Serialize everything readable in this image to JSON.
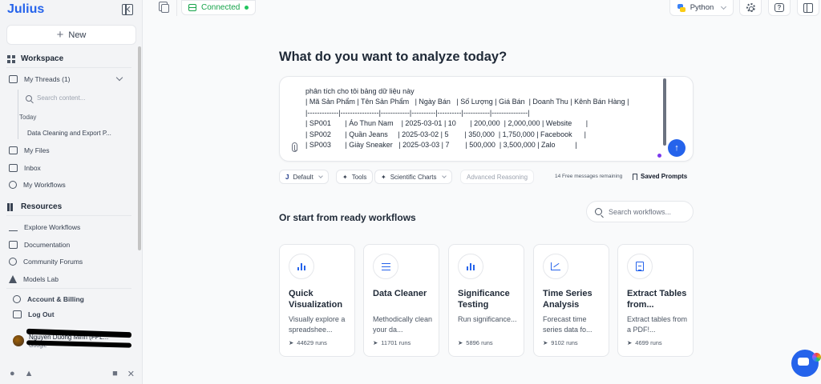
{
  "sidebar": {
    "logo": "Julius",
    "new_label": "New",
    "workspace_title": "Workspace",
    "my_threads_label": "My Threads",
    "my_threads_count": "(1)",
    "search_placeholder": "Search content...",
    "today_label": "Today",
    "thread_item": "Data Cleaning and Export P...",
    "my_files": "My Files",
    "inbox": "Inbox",
    "my_workflows": "My Workflows",
    "resources_title": "Resources",
    "explore_workflows": "Explore Workflows",
    "documentation": "Documentation",
    "community_forums": "Community Forums",
    "models_lab": "Models Lab",
    "account_billing": "Account & Billing",
    "log_out": "Log Out",
    "user_name": "Nguyen Duong Minh (FPL...",
    "user_sub": "Google"
  },
  "topbar": {
    "connected_label": "Connected",
    "python_label": "Python"
  },
  "main": {
    "heading": "What do you want to analyze today?",
    "prompt_text": "phân tích cho tôi bảng dữ liệu này\n| Mã Sản Phẩm | Tên Sản Phẩm   | Ngày Bán   | Số Lượng | Giá Bán  | Doanh Thu | Kênh Bán Hàng |\n|-------------|----------------|------------|----------|----------|-----------|---------------|\n| SP001       | Áo Thun Nam    | 2025-03-01 | 10       | 200,000  | 2,000,000 | Website       |\n| SP002       | Quần Jeans     | 2025-03-02 | 5        | 350,000  | 1,750,000 | Facebook      |\n| SP003       | Giày Sneaker   | 2025-03-03 | 7        | 500,000  | 3,500,000 | Zalo          |",
    "options": {
      "default_label": "Default",
      "tools_label": "Tools",
      "scientific_label": "Scientific Charts",
      "advanced_label": "Advanced Reasoning",
      "free_messages": "14 Free messages remaining",
      "saved_prompts": "Saved Prompts"
    },
    "workflows_heading": "Or start from ready workflows",
    "workflow_search_placeholder": "Search workflows...",
    "cards": [
      {
        "title": "Quick Visualization",
        "desc": "Visually explore a spreadshee...",
        "runs": "44629 runs",
        "icon": "bar-chart-icon"
      },
      {
        "title": "Data Cleaner",
        "desc": "Methodically clean your da...",
        "runs": "11701 runs",
        "icon": "sliders-icon"
      },
      {
        "title": "Significance Testing",
        "desc": "Run significance...",
        "runs": "5896 runs",
        "icon": "bar-chart-icon"
      },
      {
        "title": "Time Series Analysis",
        "desc": "Forecast time series data fo...",
        "runs": "9102 runs",
        "icon": "line-chart-icon"
      },
      {
        "title": "Extract Tables from...",
        "desc": "Extract tables from a PDF!...",
        "runs": "4699 runs",
        "icon": "document-icon"
      }
    ]
  },
  "colors": {
    "accent": "#2563eb",
    "connected_green": "#16a34a",
    "sidebar_bg": "#f3f4f6"
  }
}
